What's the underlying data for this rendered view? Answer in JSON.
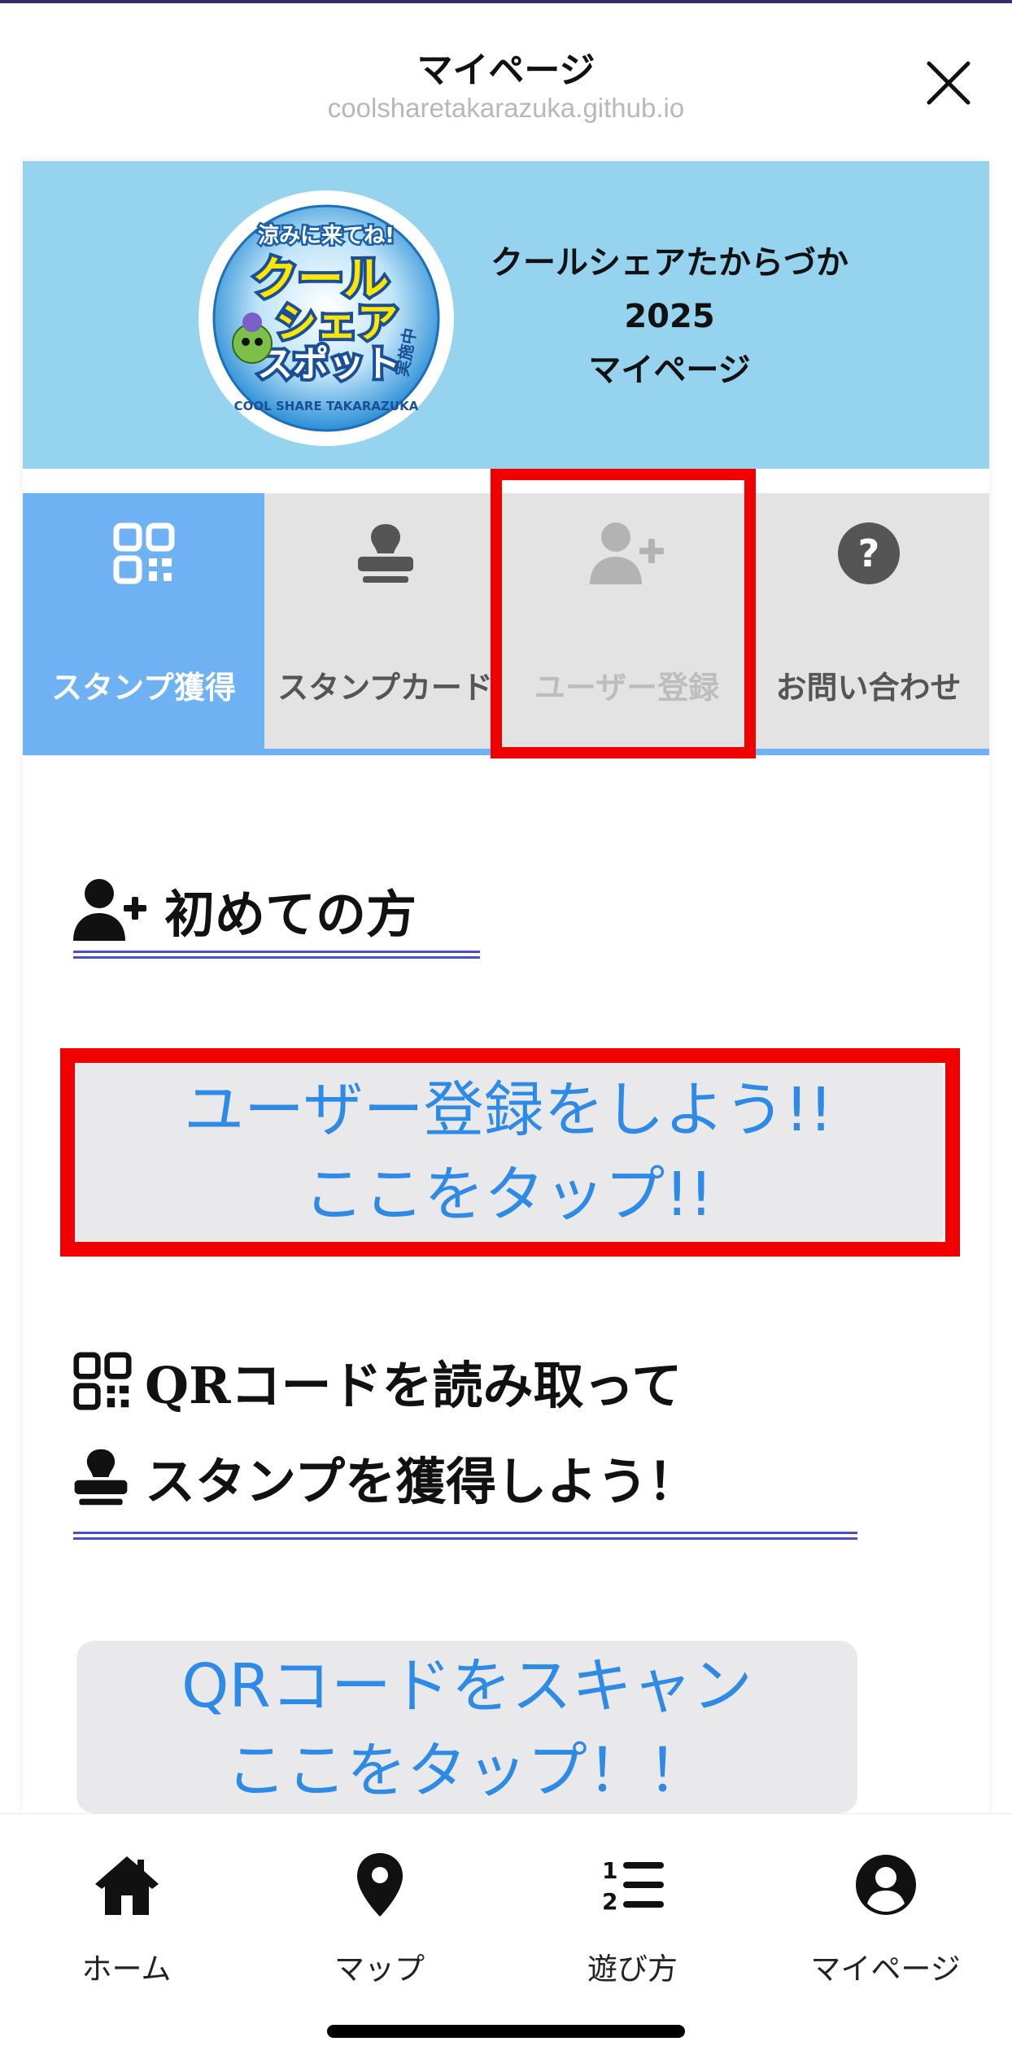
{
  "sheet": {
    "title": "マイページ",
    "url": "coolsharetakarazuka.github.io"
  },
  "banner": {
    "logo_alt": "クールシェアスポット 実施中 COOL SHARE TAKARAZUKA",
    "title_lines": [
      "クールシェアたからづか",
      "2025",
      "マイページ"
    ]
  },
  "tabs": [
    {
      "label": "スタンプ獲得",
      "icon": "qr-code-icon",
      "state": "active"
    },
    {
      "label": "スタンプカード",
      "icon": "stamp-icon",
      "state": "normal"
    },
    {
      "label": "ユーザー登録",
      "icon": "user-plus-icon",
      "state": "highlighted"
    },
    {
      "label": "お問い合わせ",
      "icon": "question-circle-icon",
      "state": "normal"
    }
  ],
  "section_new": {
    "heading": "初めての方",
    "button_line1": "ユーザー登録をしよう!!",
    "button_line2": "ここをタップ!!"
  },
  "section_scan": {
    "heading_line1": "QRコードを読み取って",
    "heading_line2": "スタンプを獲得しよう！",
    "button_line1": "QRコードをスキャン",
    "button_line2": "ここをタップ！！"
  },
  "bottom_nav": [
    {
      "label": "ホーム",
      "icon": "home-icon"
    },
    {
      "label": "マップ",
      "icon": "map-pin-icon"
    },
    {
      "label": "遊び方",
      "icon": "numbered-list-icon"
    },
    {
      "label": "マイページ",
      "icon": "user-circle-icon"
    }
  ],
  "colors": {
    "banner_bg": "#95d3ee",
    "active_tab": "#6fb2f3",
    "link_blue": "#2d8ae6",
    "highlight_red": "#f00000"
  }
}
